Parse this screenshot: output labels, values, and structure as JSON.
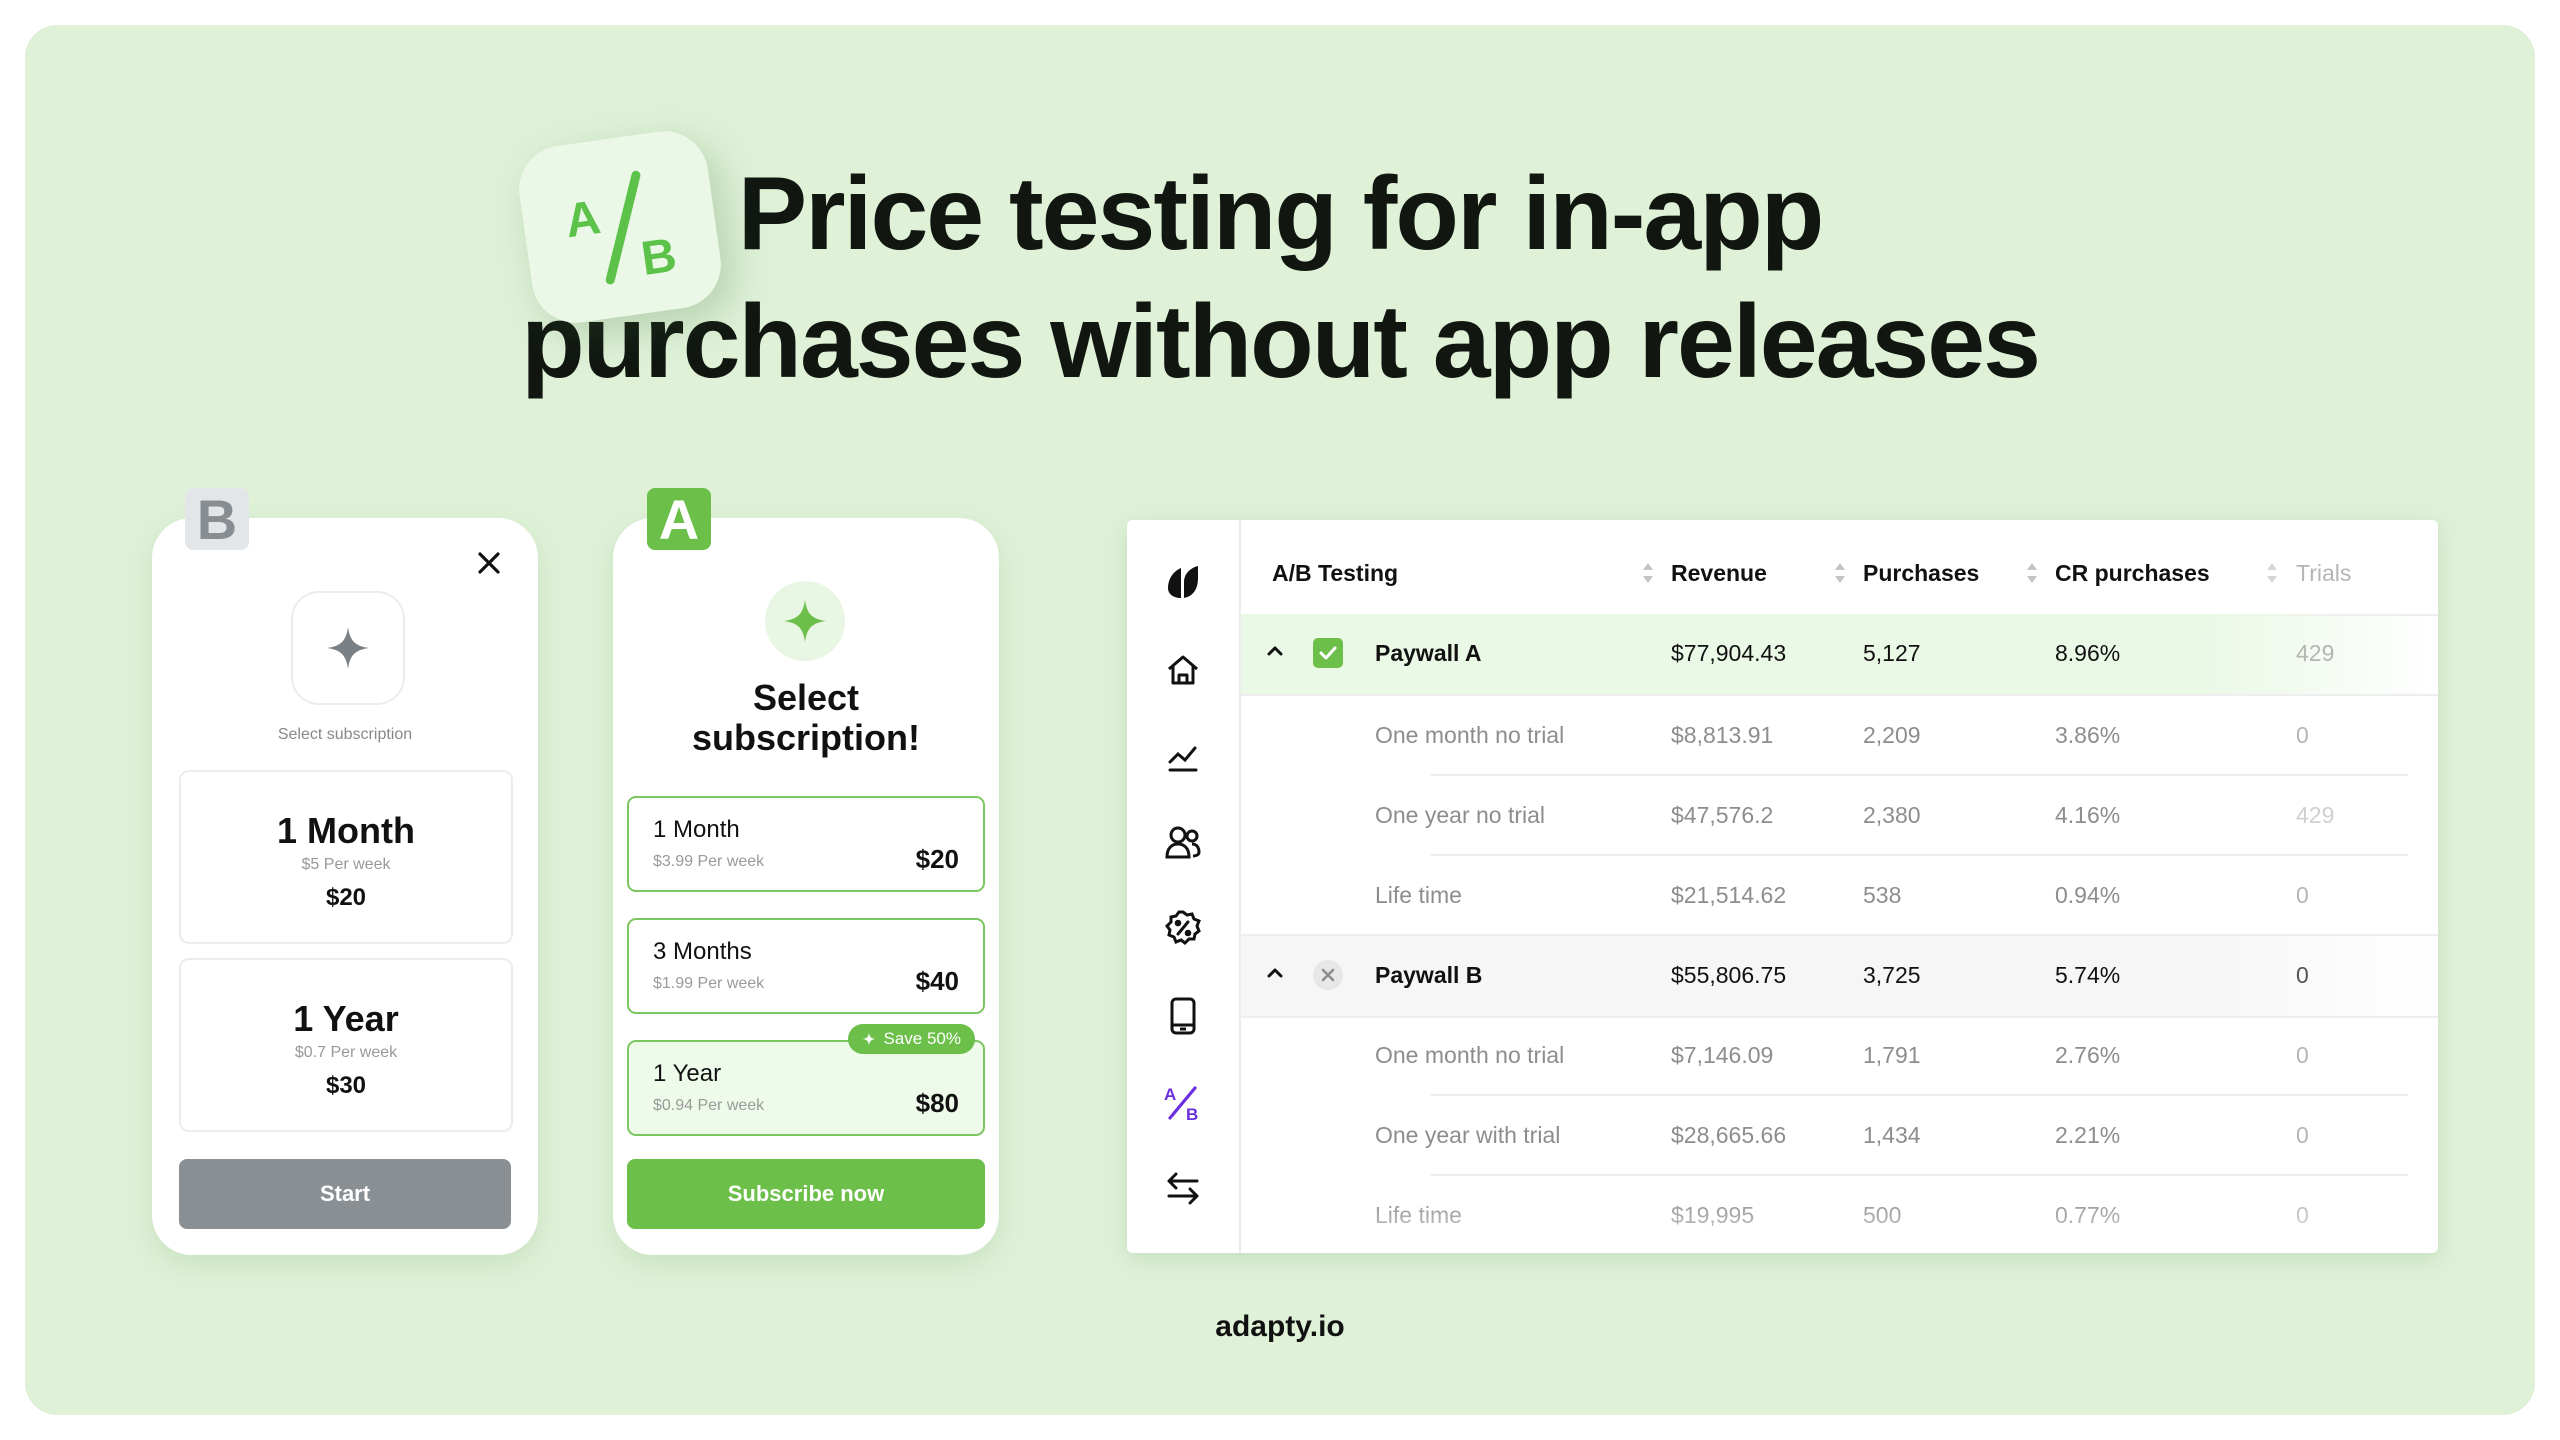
{
  "headline": {
    "line1": "Price testing for in-app",
    "line2": "purchases without app releases",
    "logo_icon": "ab-test-icon"
  },
  "colors": {
    "background": "#dff2d8",
    "accent_green": "#6cc04a",
    "variant_b_gray": "#8a8f93",
    "ab_active_purple": "#6b2fe0"
  },
  "variant_b": {
    "tag": "B",
    "close_icon": "close-icon",
    "hero_icon": "sparkle-icon",
    "subtitle": "Select subscription",
    "options": [
      {
        "title": "1 Month",
        "per_week": "$5 Per week",
        "price": "$20"
      },
      {
        "title": "1 Year",
        "per_week": "$0.7 Per week",
        "price": "$30"
      }
    ],
    "cta": "Start"
  },
  "variant_a": {
    "tag": "A",
    "hero_icon": "sparkle-icon",
    "heading_line1": "Select",
    "heading_line2": "subscription!",
    "options": [
      {
        "title": "1 Month",
        "per_week": "$3.99 Per week",
        "price": "$20"
      },
      {
        "title": "3 Months",
        "per_week": "$1.99 Per week",
        "price": "$40"
      },
      {
        "title": "1 Year",
        "per_week": "$0.94 Per week",
        "price": "$80",
        "badge": "Save 50%",
        "selected": true
      }
    ],
    "cta": "Subscribe now"
  },
  "dashboard": {
    "sidebar": [
      {
        "icon": "adapty-logo-icon"
      },
      {
        "icon": "home-icon"
      },
      {
        "icon": "analytics-chart-icon"
      },
      {
        "icon": "users-icon"
      },
      {
        "icon": "discount-badge-icon"
      },
      {
        "icon": "mobile-device-icon"
      },
      {
        "icon": "ab-test-icon",
        "active": true
      },
      {
        "icon": "transfer-arrows-icon"
      }
    ],
    "columns": [
      "A/B Testing",
      "Revenue",
      "Purchases",
      "CR purchases",
      "Trials"
    ],
    "groups": [
      {
        "name": "Paywall A",
        "status": "winner-checked",
        "revenue": "$77,904.43",
        "purchases": "5,127",
        "cr": "8.96%",
        "trials": "429",
        "products": [
          {
            "name": "One month no trial",
            "revenue": "$8,813.91",
            "purchases": "2,209",
            "cr": "3.86%",
            "trials": "0"
          },
          {
            "name": "One year no trial",
            "revenue": "$47,576.2",
            "purchases": "2,380",
            "cr": "4.16%",
            "trials": "429"
          },
          {
            "name": "Life time",
            "revenue": "$21,514.62",
            "purchases": "538",
            "cr": "0.94%",
            "trials": "0"
          }
        ]
      },
      {
        "name": "Paywall B",
        "status": "excluded",
        "revenue": "$55,806.75",
        "purchases": "3,725",
        "cr": "5.74%",
        "trials": "0",
        "products": [
          {
            "name": "One month no trial",
            "revenue": "$7,146.09",
            "purchases": "1,791",
            "cr": "2.76%",
            "trials": "0"
          },
          {
            "name": "One year with trial",
            "revenue": "$28,665.66",
            "purchases": "1,434",
            "cr": "2.21%",
            "trials": "0"
          },
          {
            "name": "Life time",
            "revenue": "$19,995",
            "purchases": "500",
            "cr": "0.77%",
            "trials": "0"
          }
        ]
      }
    ]
  },
  "footer": "adapty.io"
}
